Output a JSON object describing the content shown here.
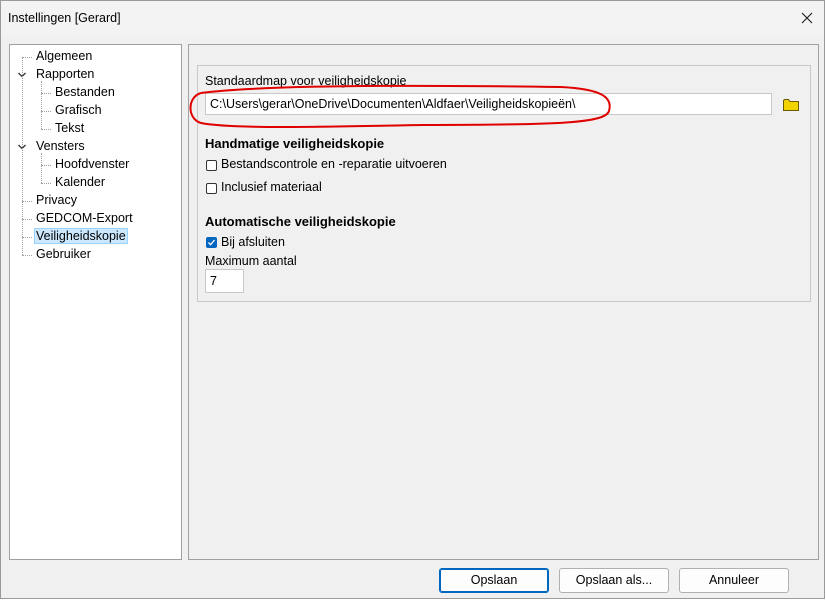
{
  "window": {
    "title": "Instellingen [Gerard]"
  },
  "tree": {
    "items": [
      {
        "label": "Algemeen",
        "level": 0,
        "expanded": null
      },
      {
        "label": "Rapporten",
        "level": 0,
        "expanded": true
      },
      {
        "label": "Bestanden",
        "level": 1,
        "expanded": null
      },
      {
        "label": "Grafisch",
        "level": 1,
        "expanded": null
      },
      {
        "label": "Tekst",
        "level": 1,
        "expanded": null
      },
      {
        "label": "Vensters",
        "level": 0,
        "expanded": true
      },
      {
        "label": "Hoofdvenster",
        "level": 1,
        "expanded": null
      },
      {
        "label": "Kalender",
        "level": 1,
        "expanded": null
      },
      {
        "label": "Privacy",
        "level": 0,
        "expanded": null
      },
      {
        "label": "GEDCOM-Export",
        "level": 0,
        "expanded": null
      },
      {
        "label": "Veiligheidskopie",
        "level": 0,
        "expanded": null,
        "selected": true
      },
      {
        "label": "Gebruiker",
        "level": 0,
        "expanded": null
      }
    ]
  },
  "backup": {
    "folder_label": "Standaardmap voor veiligheidskopie",
    "folder_value": "C:\\Users\\gerar\\OneDrive\\Documenten\\Aldfaer\\Veiligheidskopieën\\",
    "manual_heading": "Handmatige veiligheidskopie",
    "manual_check1": {
      "label": "Bestandscontrole en -reparatie uitvoeren",
      "checked": false
    },
    "manual_check2": {
      "label": "Inclusief materiaal",
      "checked": false
    },
    "auto_heading": "Automatische veiligheidskopie",
    "auto_check1": {
      "label": "Bij afsluiten",
      "checked": true
    },
    "max_label": "Maximum aantal",
    "max_value": "7"
  },
  "buttons": {
    "save": "Opslaan",
    "save_as": "Opslaan als...",
    "cancel": "Annuleer"
  },
  "colors": {
    "accent": "#0067c0",
    "selection": "#cce8ff",
    "annotation": "#e00000",
    "folder": "#f2d300"
  }
}
